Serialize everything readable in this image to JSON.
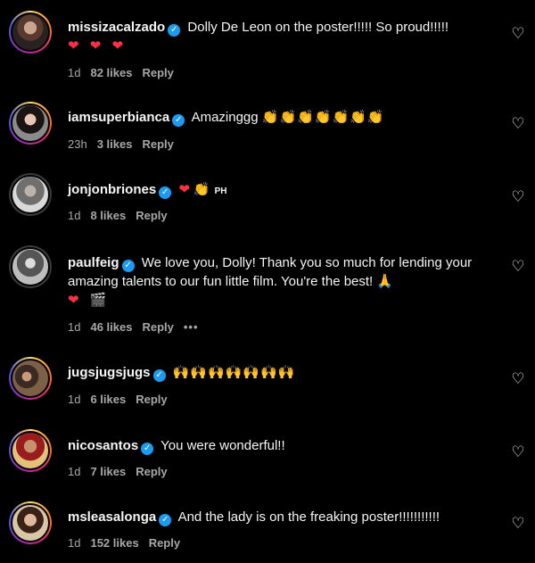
{
  "comments": [
    {
      "username": "missizacalzado",
      "text": "Dolly De Leon on the poster!!!!! So proud!!!!!",
      "emojis": "❤ ❤ ❤",
      "time": "1d",
      "likes": "82 likes",
      "reply": "Reply"
    },
    {
      "username": "iamsuperbianca",
      "text": "Amazinggg",
      "emojis": "👏👏👏👏👏👏👏",
      "time": "23h",
      "likes": "3 likes",
      "reply": "Reply"
    },
    {
      "username": "jonjonbriones",
      "text": "",
      "emojis": "❤",
      "hand": "👏",
      "flag": "PH",
      "time": "1d",
      "likes": "8 likes",
      "reply": "Reply"
    },
    {
      "username": "paulfeig",
      "text": "We love you, Dolly! Thank you so much for lending your amazing talents to our fun little film. You're the best! 🙏",
      "emojis": "❤ 🎬",
      "time": "1d",
      "likes": "46 likes",
      "reply": "Reply",
      "more": "•••"
    },
    {
      "username": "jugsjugsjugs",
      "text": "",
      "emojis": "🙌🙌🙌🙌🙌🙌🙌",
      "time": "1d",
      "likes": "6 likes",
      "reply": "Reply"
    },
    {
      "username": "nicosantos",
      "text": "You were wonderful!!",
      "time": "1d",
      "likes": "7 likes",
      "reply": "Reply"
    },
    {
      "username": "msleasalonga",
      "text": "And the lady is on the freaking poster!!!!!!!!!!!",
      "time": "1d",
      "likes": "152 likes",
      "reply": "Reply"
    }
  ],
  "icons": {
    "verified": "verified-badge-icon",
    "like": "heart-outline-icon"
  },
  "colors": {
    "background": "#000000",
    "verified": "#1d9bf0",
    "heart": "#ff3040",
    "meta": "#a8a8a8"
  }
}
